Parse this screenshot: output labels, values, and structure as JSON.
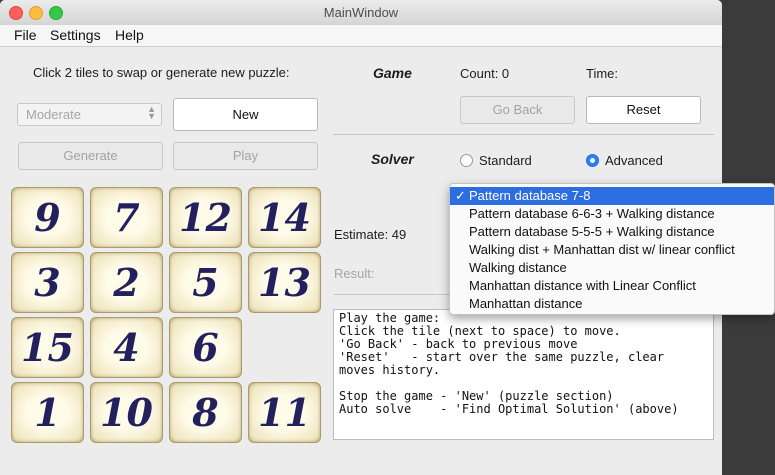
{
  "window": {
    "title": "MainWindow"
  },
  "menu": [
    "File",
    "Settings",
    "Help"
  ],
  "puzzle": {
    "instruction": "Click 2 tiles to swap or generate new puzzle:",
    "difficulty": "Moderate",
    "new_label": "New",
    "generate_label": "Generate",
    "play_label": "Play"
  },
  "game": {
    "heading": "Game",
    "count_label": "Count: 0",
    "time_label": "Time:",
    "go_back_label": "Go Back",
    "reset_label": "Reset"
  },
  "solver": {
    "heading": "Solver",
    "standard_label": "Standard",
    "advanced_label": "Advanced",
    "selected_mode": "Advanced",
    "estimate_label": "Estimate: 49",
    "result_label": "Result:",
    "options": [
      "Pattern database 7-8",
      "Pattern database 6-6-3 + Walking distance",
      "Pattern database 5-5-5 + Walking distance",
      "Walking dist + Manhattan dist w/ linear conflict",
      "Walking distance",
      "Manhattan distance with Linear Conflict",
      "Manhattan distance"
    ],
    "selected_option": "Pattern database 7-8",
    "check_mark": "✓"
  },
  "board": {
    "tiles": [
      "9",
      "7",
      "12",
      "14",
      "3",
      "2",
      "5",
      "13",
      "15",
      "4",
      "6",
      "",
      "1",
      "10",
      "8",
      "11"
    ]
  },
  "help_text": [
    "Play the game:",
    "Click the tile (next to space) to move.",
    "'Go Back' - back to previous move",
    "'Reset'   - start over the same puzzle, clear",
    "moves history.",
    "",
    "Stop the game - 'New' (puzzle section)",
    "Auto solve    - 'Find Optimal Solution' (above)"
  ]
}
